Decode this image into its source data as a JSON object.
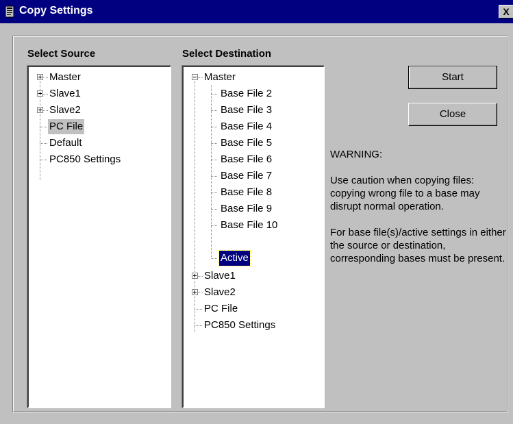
{
  "window": {
    "title": "Copy Settings",
    "close_label": "X"
  },
  "source": {
    "label": "Select Source",
    "items": [
      {
        "label": "Master",
        "expander": "plus"
      },
      {
        "label": "Slave1",
        "expander": "plus"
      },
      {
        "label": "Slave2",
        "expander": "plus"
      },
      {
        "label": "PC File",
        "state": "selected-inactive"
      },
      {
        "label": "Default"
      },
      {
        "label": "PC850 Settings"
      }
    ]
  },
  "destination": {
    "label": "Select Destination",
    "items": [
      {
        "label": "Master",
        "expander": "minus"
      },
      {
        "label": "Base File 2"
      },
      {
        "label": "Base File 3"
      },
      {
        "label": "Base File 4"
      },
      {
        "label": "Base File 5"
      },
      {
        "label": "Base File 6"
      },
      {
        "label": "Base File 7"
      },
      {
        "label": "Base File 8"
      },
      {
        "label": "Base File 9"
      },
      {
        "label": "Base File 10"
      },
      {
        "label": "Active",
        "state": "selected"
      },
      {
        "label": "Slave1",
        "expander": "plus"
      },
      {
        "label": "Slave2",
        "expander": "plus"
      },
      {
        "label": "PC File"
      },
      {
        "label": "PC850 Settings"
      }
    ]
  },
  "buttons": {
    "start": "Start",
    "close": "Close"
  },
  "warning": {
    "heading": "WARNING:",
    "paragraph1": "Use caution when copying files: copying wrong file to a base may disrupt normal operation.",
    "paragraph2": "For base file(s)/active settings in either the source or destination, corresponding bases must be present."
  },
  "colors": {
    "titlebar": "#000080",
    "face": "#c0c0c0",
    "selection": "#000080"
  }
}
